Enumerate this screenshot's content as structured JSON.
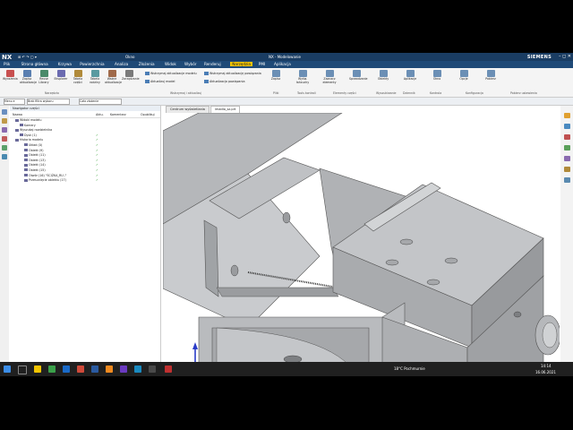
{
  "window": {
    "app_label": "NX",
    "title": "NX - Modelowanie",
    "quick_access": "Okno",
    "brand": "SIEMENS",
    "controls": "– ◻ ✕"
  },
  "menu": [
    "Plik",
    "Strona główna",
    "Krzywa",
    "Powierzchnia",
    "Analiza",
    "Złożenia",
    "Widok",
    "Wybór",
    "Renderuj",
    "Narzędzia",
    "PMI",
    "Aplikacja"
  ],
  "menu_active": "Narzędzia",
  "ribbon": {
    "buttons": [
      {
        "label": "Wyrażenia",
        "color": "#c85050"
      },
      {
        "label": "Zapisz aktualizacje",
        "color": "#5a7fb0"
      },
      {
        "label": "Reuse Library",
        "color": "#4a8a6a"
      },
      {
        "label": "Eksplorer",
        "color": "#6a6ab0"
      },
      {
        "label": "Tabela części",
        "color": "#b08a3a"
      },
      {
        "label": "Tabela rodziny",
        "color": "#5a9aa0"
      },
      {
        "label": "Ważne aktualizacje",
        "color": "#a06a4a"
      },
      {
        "label": "Zarządzanie",
        "color": "#7a7a7a"
      }
    ],
    "small_items": [
      "Wstrzymaj aktualizacje modelu",
      "Aktualizuj model",
      "Wstrzymaj aktualizację powiązania",
      "Aktualizacja powiązania"
    ],
    "right_buttons": [
      "Zapisz",
      "Wyśw. łańcuchy",
      "Zaznacz elementy",
      "Sprawdzanie",
      "Obiekty",
      "Aplikacje",
      "Okno",
      "Opcje",
      "Pobierz"
    ],
    "groups": [
      "Narzędzia",
      "Wstrzymaj i aktualizuj",
      "Pliki",
      "Tools kontroli",
      "Elementy części",
      "Wyszukiwanie",
      "Dziennik",
      "Kontrola",
      "Konfiguracja",
      "Pobierz ustawienia"
    ]
  },
  "selection_bar": {
    "menu": "Menu ▾",
    "filter": "Brak filtra wyboru",
    "scope": "Cała złożenie"
  },
  "navigator": {
    "title": "Nawigator części",
    "columns": [
      "Nazwa",
      "Aktu.",
      "Komentarz",
      "Opublikuj"
    ],
    "rows": [
      {
        "label": "Widoki modelu",
        "indent": 0,
        "check": ""
      },
      {
        "label": "Kamery",
        "indent": 1,
        "check": ""
      },
      {
        "label": "Wyszukaj rozdzielnika",
        "indent": 0,
        "check": ""
      },
      {
        "label": "Dysk (1)",
        "indent": 1,
        "check": "✓"
      },
      {
        "label": "Historia modelu",
        "indent": 0,
        "check": "✓"
      },
      {
        "label": "Układ (0)",
        "indent": 2,
        "check": "✓"
      },
      {
        "label": "Obiekt (9)",
        "indent": 2,
        "check": "✓"
      },
      {
        "label": "Obiekt (11)",
        "indent": 2,
        "check": "✓"
      },
      {
        "label": "Obiekt (13)",
        "indent": 2,
        "check": "✓"
      },
      {
        "label": "Obiekt (14)",
        "indent": 2,
        "check": "✓"
      },
      {
        "label": "Obiekt (15)",
        "indent": 2,
        "check": "✓"
      },
      {
        "label": "Otwór (16) \"ŚCIŻKA_RU..\"",
        "indent": 2,
        "check": "✓"
      },
      {
        "label": "Przesunięcie obiektu (17)",
        "indent": 2,
        "check": "✓"
      }
    ]
  },
  "tabs": [
    "Centrum wyświetlania",
    "imadlo_sz.prt"
  ],
  "active_tab": "imadlo_sz.prt",
  "taskbar": {
    "weather": "18°C  Pochmurnie",
    "time": "14:14",
    "date": "16.06.2021"
  },
  "colors": {
    "title_bg": "#1a3d63",
    "menu_bg": "#1f4a77",
    "accent": "#f2c400",
    "model_face": "#b7b9bc",
    "model_dark": "#8f9296"
  }
}
